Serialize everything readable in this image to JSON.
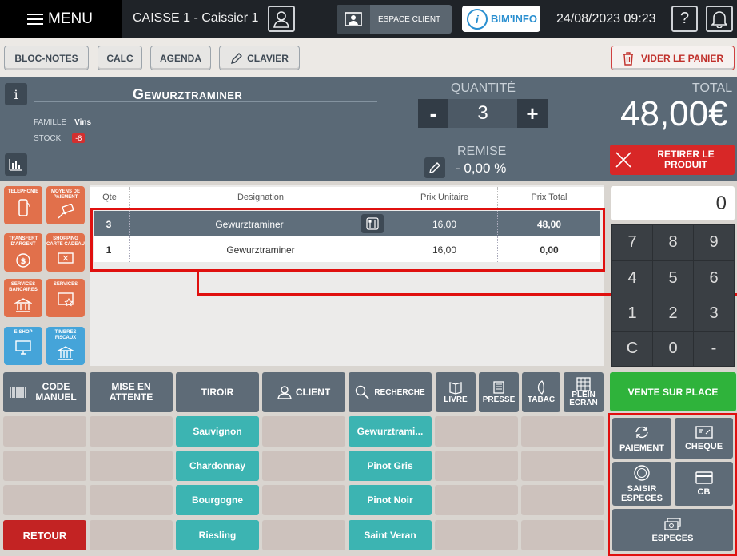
{
  "topbar": {
    "menu_label": "MENU",
    "caisse": "CAISSE 1 - Caissier 1",
    "espace_client": "ESPACE CLIENT",
    "biminfo": "BIM'INFO",
    "datetime": "24/08/2023 09:23"
  },
  "toolbar": {
    "bloc_notes": "BLOC-NOTES",
    "calc": "CALC",
    "agenda": "AGENDA",
    "clavier": "CLAVIER",
    "vider": "VIDER LE PANIER"
  },
  "product": {
    "name": "Gewurztraminer",
    "famille_label": "FAMILLE",
    "famille_value": "Vins",
    "stock_label": "STOCK",
    "stock_value": "-8",
    "quantite_label": "QUANTITÉ",
    "quantite_value": "3",
    "minus": "-",
    "plus": "+",
    "remise_label": "REMISE",
    "remise_value": "- 0,00 %",
    "total_label": "TOTAL",
    "total_value": "48,00€",
    "retirer_line1": "RETIRER LE",
    "retirer_line2": "PRODUIT"
  },
  "services": [
    {
      "label": "TELEPHONIE"
    },
    {
      "label": "MOYENS DE PAIEMENT"
    },
    {
      "label": "TRANSFERT D'ARGENT"
    },
    {
      "label": "SHOPPING CARTE CADEAU"
    },
    {
      "label": "SERVICES BANCAIRES"
    },
    {
      "label": "SERVICES"
    },
    {
      "label": "E-SHOP"
    },
    {
      "label": "TIMBRES FISCAUX"
    }
  ],
  "table": {
    "headers": [
      "Qte",
      "Designation",
      "Prix Unitaire",
      "Prix Total"
    ],
    "rows": [
      {
        "qte": "3",
        "designation": "Gewurztraminer",
        "prix_unitaire": "16,00",
        "prix_total": "48,00"
      },
      {
        "qte": "1",
        "designation": "Gewurztraminer",
        "prix_unitaire": "16,00",
        "prix_total": "0,00"
      }
    ]
  },
  "keypad": {
    "display": "0",
    "keys": [
      "7",
      "8",
      "9",
      "4",
      "5",
      "6",
      "1",
      "2",
      "3",
      "C",
      "0",
      "-"
    ]
  },
  "actions": {
    "code_manuel": "CODE MANUEL",
    "mise_en_attente": "MISE EN ATTENTE",
    "tiroir": "TIROIR",
    "client": "CLIENT",
    "recherche": "RECHERCHE",
    "livre": "LIVRE",
    "presse": "PRESSE",
    "tabac": "TABAC",
    "plein_ecran": "PLEIN ECRAN",
    "vente": "VENTE SUR PLACE",
    "retour": "RETOUR"
  },
  "grid": {
    "col3": [
      "Sauvignon",
      "Chardonnay",
      "Bourgogne",
      "Riesling"
    ],
    "col5": [
      "Gewurztrami...",
      "Pinot Gris",
      "Pinot Noir",
      "Saint Veran"
    ]
  },
  "payment": {
    "paiement": "PAIEMENT",
    "cheque": "CHEQUE",
    "saisir_line1": "SAISIR",
    "saisir_line2": "ESPECES",
    "cb": "CB",
    "especes": "ESPECES"
  }
}
